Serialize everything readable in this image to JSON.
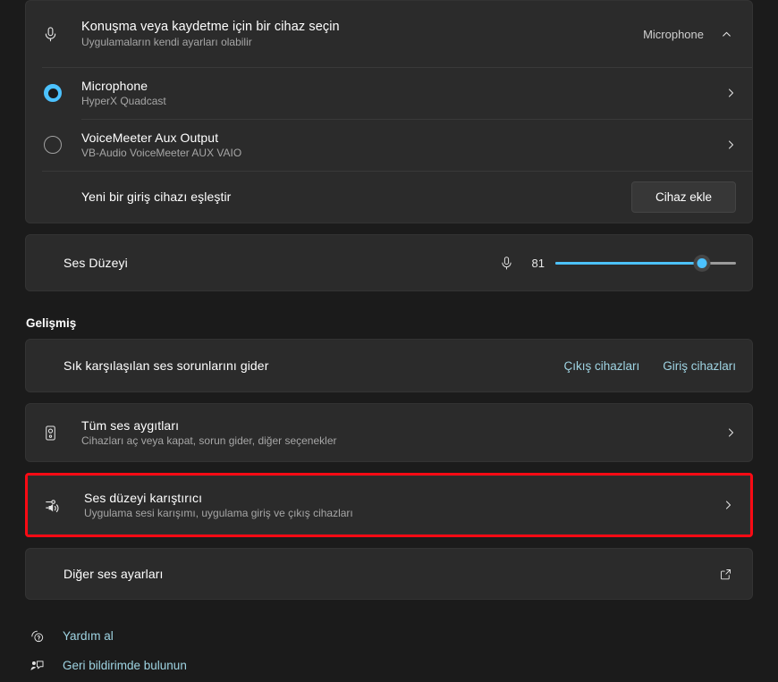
{
  "input_section": {
    "header": {
      "icon": "microphone-icon",
      "title": "Konuşma veya kaydetme için bir cihaz seçin",
      "subtitle": "Uygulamaların kendi ayarları olabilir",
      "selected_value": "Microphone",
      "expand_icon": "chevron-up-icon"
    },
    "devices": [
      {
        "name": "Microphone",
        "description": "HyperX Quadcast",
        "selected": true,
        "chevron": "chevron-right-icon"
      },
      {
        "name": "VoiceMeeter Aux Output",
        "description": "VB-Audio VoiceMeeter AUX VAIO",
        "selected": false,
        "chevron": "chevron-right-icon"
      }
    ],
    "pair_row": {
      "label": "Yeni bir giriş cihazı eşleştir",
      "button_label": "Cihaz ekle"
    }
  },
  "volume": {
    "label": "Ses Düzeyi",
    "icon": "microphone-icon",
    "value": "81",
    "percent": 81,
    "accent_color": "#4cc2ff"
  },
  "advanced": {
    "section_title": "Gelişmiş",
    "troubleshoot": {
      "label": "Sık karşılaşılan ses sorunlarını gider",
      "output_link": "Çıkış cihazları",
      "input_link": "Giriş cihazları"
    },
    "all_devices": {
      "icon": "speaker-icon",
      "title": "Tüm ses aygıtları",
      "subtitle": "Cihazları aç veya kapat, sorun gider, diğer seçenekler",
      "chevron": "chevron-right-icon"
    },
    "volume_mixer": {
      "icon": "volume-mixer-icon",
      "title": "Ses düzeyi karıştırıcı",
      "subtitle": "Uygulama sesi karışımı, uygulama giriş ve çıkış cihazları",
      "chevron": "chevron-right-icon",
      "highlighted": true,
      "highlight_color": "#fb0a14"
    },
    "other_settings": {
      "title": "Diğer ses ayarları",
      "icon": "external-link-icon"
    }
  },
  "footer": {
    "links": [
      {
        "label": "Yardım al",
        "icon": "help-icon"
      },
      {
        "label": "Geri bildirimde bulunun",
        "icon": "feedback-icon"
      }
    ],
    "link_color": "#9fd4e3"
  }
}
